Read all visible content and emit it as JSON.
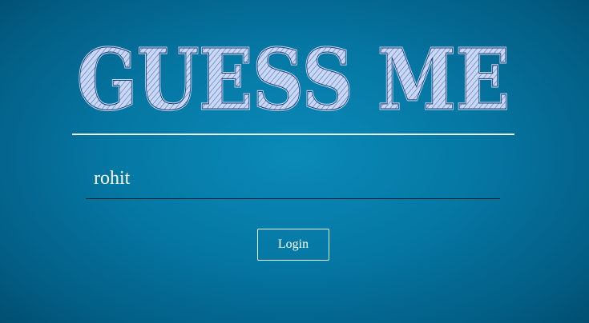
{
  "app": {
    "title": "GUESS ME"
  },
  "login_form": {
    "username_value": "rohit",
    "login_label": "Login"
  },
  "colors": {
    "background": "#0577a3",
    "title_fill": "#c9d8f7",
    "title_stroke": "#1c3f6e",
    "text": "#ffffff",
    "divider": "#e8eef2",
    "input_underline": "#0b1e2a"
  }
}
